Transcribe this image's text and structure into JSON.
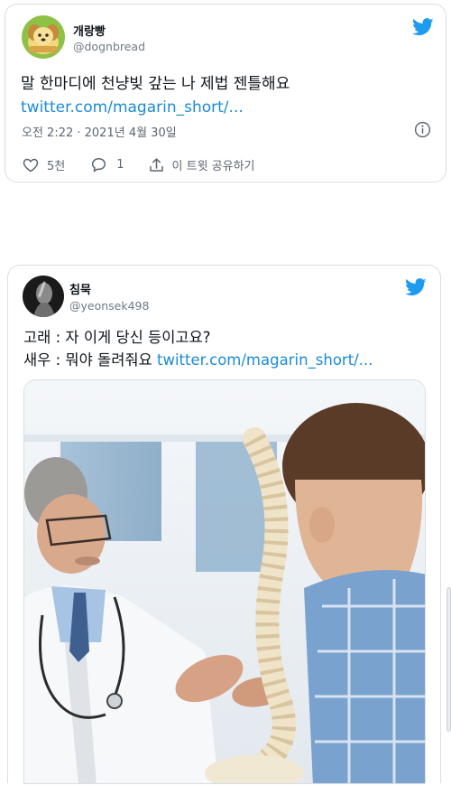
{
  "tweet1": {
    "name": "개랑빵",
    "handle": "@dognbread",
    "text": "말 한마디에 천냥빚 갚는 나 제법 젠틀해요",
    "link": "twitter.com/magarin_short/...",
    "timestamp": "오전 2:22 · 2021년 4월 30일",
    "likes": "5천",
    "replies": "1",
    "share_label": "이 트윗 공유하기",
    "icons": [
      "heart-icon",
      "reply-icon",
      "share-icon",
      "info-icon",
      "twitter-bird-icon"
    ]
  },
  "tweet2": {
    "name": "침묵",
    "handle": "@yeonsek498",
    "line1": "고래 : 자 이게 당신 등이고요?",
    "line2_prefix": "새우 : 뭐야 돌려줘요 ",
    "line2_link": "twitter.com/magarin_short/...",
    "icons": [
      "twitter-bird-icon"
    ]
  },
  "colors": {
    "accent": "#1d9bf0",
    "link": "#1b8bd6",
    "text": "#0f1419",
    "secondary": "#5b6670",
    "border": "#d9dfe4"
  }
}
